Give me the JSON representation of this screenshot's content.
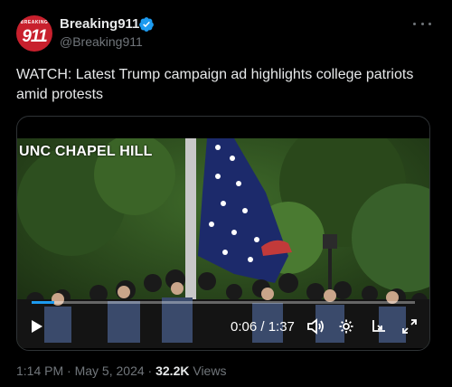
{
  "account": {
    "name": "Breaking911",
    "handle": "@Breaking911",
    "avatar_small": "BREAKING",
    "avatar_big": "911"
  },
  "tweet": {
    "text": "WATCH: Latest Trump campaign ad highlights college patriots amid protests"
  },
  "video": {
    "caption": "UNC CHAPEL HILL",
    "time": "0:06 / 1:37",
    "progress_fraction": 0.06
  },
  "footer": {
    "time": "1:14 PM",
    "sep1": " · ",
    "date": "May 5, 2024",
    "sep2": " · ",
    "views_count": "32.2K",
    "views_label": " Views"
  },
  "colors": {
    "background": "#000000",
    "verified": "#1d9bf0",
    "avatar": "#c8202d",
    "muted_text": "#71767b"
  }
}
